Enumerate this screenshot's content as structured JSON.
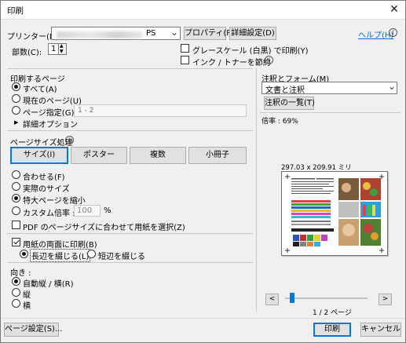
{
  "window": {
    "title": "印刷",
    "close_glyph": "✕"
  },
  "printer": {
    "label": "プリンター(N):",
    "selected_suffix": "PS",
    "properties_label": "プロパティ(P)",
    "advanced_label": "詳細設定(D)",
    "help_label": "ヘルプ(H)"
  },
  "copies": {
    "label": "部数(C):",
    "value": "1"
  },
  "options": {
    "grayscale_label": "グレースケール (白黒) で印刷(Y)",
    "grayscale_checked": false,
    "inksave_label": "インク / トナーを節約",
    "inksave_checked": false
  },
  "pages": {
    "heading": "印刷するページ",
    "all_label": "すべて(A)",
    "current_label": "現在のページ(U)",
    "range_label": "ページ指定(G)",
    "range_placeholder": "1 - 2",
    "more_options_label": "詳細オプション",
    "selected": "all"
  },
  "page_sizing": {
    "heading": "ページサイズ処理",
    "tabs": [
      "サイズ(I)",
      "ポスター",
      "複数",
      "小冊子"
    ],
    "fit_label": "合わせる(F)",
    "actual_label": "実際のサイズ",
    "shrink_label": "特大ページを縮小",
    "custom_label": "カスタム倍率 :",
    "custom_value": "100",
    "custom_unit": "%",
    "selected": "shrink",
    "pdf_paper_label": "PDF のページサイズに合わせて用紙を選択(Z)",
    "pdf_paper_checked": false
  },
  "duplex": {
    "label": "用紙の両面に印刷(B)",
    "checked": true,
    "long_edge_label": "長辺を綴じる(L)",
    "short_edge_label": "短辺を綴じる",
    "selected": "long"
  },
  "orientation": {
    "heading": "向き :",
    "auto_label": "自動縦 / 横(R)",
    "portrait_label": "縦",
    "landscape_label": "横",
    "selected": "auto"
  },
  "annotations": {
    "heading": "注釈とフォーム(M)",
    "selected_value": "文書と注釈",
    "summary_button": "注釈の一覧(T)"
  },
  "preview": {
    "scale_label": "倍率 : 69%",
    "dimensions": "297.03 x 209.91 ミリ",
    "page_indicator": "1 / 2 ページ",
    "prev_glyph": "<",
    "next_glyph": ">",
    "page_fraction": 0.0
  },
  "footer": {
    "page_setup_label": "ページ設定(S)...",
    "print_label": "印刷",
    "cancel_label": "キャンセル"
  },
  "icons": {
    "info": "i",
    "dropdown": "⌄",
    "triangle": "▶",
    "spin_up": "▲",
    "spin_down": "▼"
  },
  "colors": {
    "accent": "#0078d7",
    "link": "#0066cc",
    "dialog_bg": "#f0f0f0"
  }
}
